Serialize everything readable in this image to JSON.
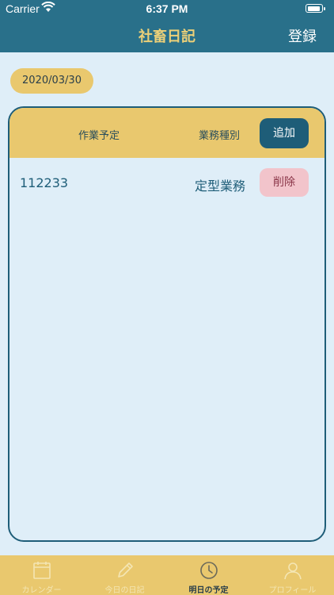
{
  "status_bar": {
    "carrier": "Carrier",
    "time": "6:37 PM"
  },
  "nav": {
    "title": "社畜日記",
    "register_label": "登録"
  },
  "date": "2020/03/30",
  "table": {
    "headers": {
      "task": "作業予定",
      "type": "業務種別"
    },
    "add_label": "追加",
    "rows": [
      {
        "task": "112233",
        "type": "定型業務",
        "delete_label": "削除"
      }
    ]
  },
  "tabs": [
    {
      "label": "カレンダー",
      "icon": "calendar-icon"
    },
    {
      "label": "今日の日記",
      "icon": "pencil-icon"
    },
    {
      "label": "明日の予定",
      "icon": "clock-icon"
    },
    {
      "label": "プロフィール",
      "icon": "person-icon"
    }
  ],
  "colors": {
    "nav_bg": "#29708a",
    "title": "#ecd078",
    "accent_yellow": "#e9c86e",
    "dark_teal": "#1e5d78",
    "delete_pink": "#f2c4cb",
    "background": "#dfeef8"
  }
}
